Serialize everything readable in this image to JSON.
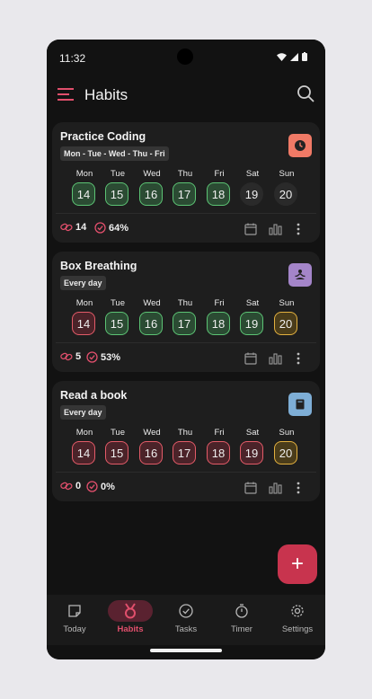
{
  "status": {
    "time": "11:32"
  },
  "appbar": {
    "title": "Habits"
  },
  "habits": [
    {
      "name": "Practice Coding",
      "frequency": "Mon - Tue - Wed - Thu - Fri",
      "icon": "clock-icon",
      "icon_color": "#f07a66",
      "days": [
        {
          "label": "Mon",
          "num": "14",
          "state": "done"
        },
        {
          "label": "Tue",
          "num": "15",
          "state": "done"
        },
        {
          "label": "Wed",
          "num": "16",
          "state": "done"
        },
        {
          "label": "Thu",
          "num": "17",
          "state": "done"
        },
        {
          "label": "Fri",
          "num": "18",
          "state": "done"
        },
        {
          "label": "Sat",
          "num": "19",
          "state": "pending"
        },
        {
          "label": "Sun",
          "num": "20",
          "state": "pending"
        }
      ],
      "streak": "14",
      "completion": "64%"
    },
    {
      "name": "Box Breathing",
      "frequency": "Every day",
      "icon": "meditation-icon",
      "icon_color": "#a485c9",
      "days": [
        {
          "label": "Mon",
          "num": "14",
          "state": "missed"
        },
        {
          "label": "Tue",
          "num": "15",
          "state": "done"
        },
        {
          "label": "Wed",
          "num": "16",
          "state": "done"
        },
        {
          "label": "Thu",
          "num": "17",
          "state": "done"
        },
        {
          "label": "Fri",
          "num": "18",
          "state": "done"
        },
        {
          "label": "Sat",
          "num": "19",
          "state": "done"
        },
        {
          "label": "Sun",
          "num": "20",
          "state": "partial"
        }
      ],
      "streak": "5",
      "completion": "53%"
    },
    {
      "name": "Read a book",
      "frequency": "Every day",
      "icon": "book-icon",
      "icon_color": "#7eaed6",
      "days": [
        {
          "label": "Mon",
          "num": "14",
          "state": "missed"
        },
        {
          "label": "Tue",
          "num": "15",
          "state": "missed"
        },
        {
          "label": "Wed",
          "num": "16",
          "state": "missed"
        },
        {
          "label": "Thu",
          "num": "17",
          "state": "missed"
        },
        {
          "label": "Fri",
          "num": "18",
          "state": "missed"
        },
        {
          "label": "Sat",
          "num": "19",
          "state": "missed"
        },
        {
          "label": "Sun",
          "num": "20",
          "state": "partial"
        }
      ],
      "streak": "0",
      "completion": "0%"
    }
  ],
  "fab": {
    "label": "+"
  },
  "nav": [
    {
      "label": "Today",
      "icon": "today-icon",
      "active": false
    },
    {
      "label": "Habits",
      "icon": "medal-icon",
      "active": true
    },
    {
      "label": "Tasks",
      "icon": "check-circle-icon",
      "active": false
    },
    {
      "label": "Timer",
      "icon": "timer-icon",
      "active": false
    },
    {
      "label": "Settings",
      "icon": "gear-icon",
      "active": false
    }
  ],
  "colors": {
    "accent": "#e14f6c",
    "done": "#5cc374",
    "missed": "#e35b68",
    "partial": "#e2b03f"
  }
}
